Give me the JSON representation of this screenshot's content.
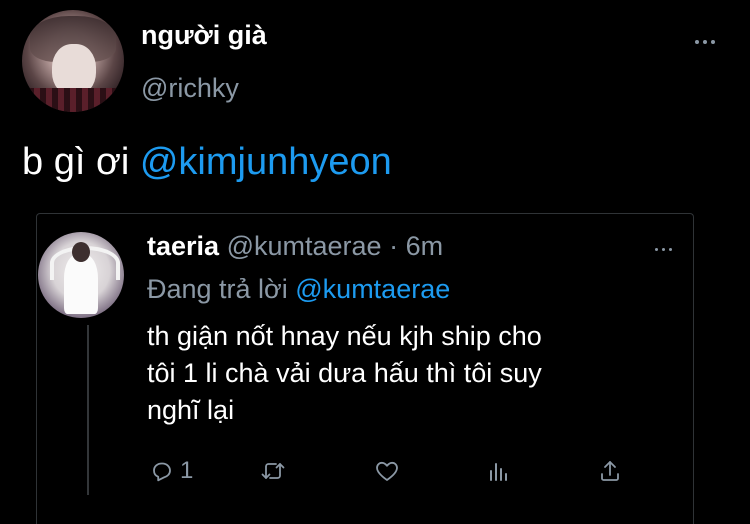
{
  "tweet": {
    "author": {
      "display_name": "người già",
      "handle": "@richky",
      "avatar": "user-avatar"
    },
    "text_plain": "b gì ơi ",
    "text_mention": "@kimjunhyeon"
  },
  "quoted": {
    "author": {
      "display_name": "taeria",
      "handle": "@kumtaerae",
      "separator": " · ",
      "time": "6m",
      "avatar": "user-avatar"
    },
    "replying_prefix": "Đang trả lời ",
    "replying_to": "@kumtaerae",
    "body_lines": [
      "th giận nốt hnay nếu kjh ship cho",
      "tôi 1 li chà vải dưa hấu thì tôi suy",
      "nghĩ lại"
    ],
    "actions": {
      "reply_count": "1",
      "icons": [
        "reply-icon",
        "retweet-icon",
        "like-icon",
        "stats-icon",
        "share-icon"
      ]
    }
  },
  "colors": {
    "background": "#000000",
    "text": "#ffffff",
    "secondary": "#8b98a5",
    "accent": "#1d9bf0",
    "border": "#2f3336"
  }
}
